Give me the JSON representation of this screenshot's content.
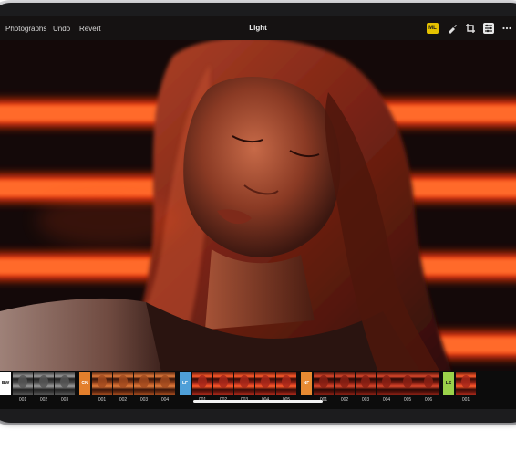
{
  "toolbar": {
    "photographs_label": "Photographs",
    "undo_label": "Undo",
    "revert_label": "Revert",
    "title": "Light",
    "ml_badge": "ML",
    "icons": [
      "ml-badge",
      "brush-icon",
      "crop-icon",
      "sliders-icon",
      "more-icon"
    ]
  },
  "filmstrip": {
    "groups": [
      {
        "tag": "BW",
        "color": "#ffffff",
        "tagText": "#111111",
        "tone": "bw",
        "thumbs": [
          "001",
          "002",
          "003"
        ]
      },
      {
        "tag": "CN",
        "color": "#e37f2c",
        "tagText": "#ffffff",
        "tone": "warm",
        "thumbs": [
          "001",
          "002",
          "003",
          "004"
        ]
      },
      {
        "tag": "LF",
        "color": "#4e9fd8",
        "tagText": "#ffffff",
        "tone": "red",
        "thumbs": [
          "001",
          "002",
          "003",
          "004",
          "005"
        ]
      },
      {
        "tag": "NF",
        "color": "#e78a32",
        "tagText": "#ffffff",
        "tone": "deep",
        "thumbs": [
          "001",
          "002",
          "003",
          "004",
          "005",
          "006"
        ]
      },
      {
        "tag": "LS",
        "color": "#9ad24a",
        "tagText": "#111111",
        "tone": "red",
        "thumbs": [
          "001"
        ]
      }
    ]
  },
  "colors": {
    "accent_ml": "#e6c200",
    "neon": "#ff4a12",
    "background": "#0d0909"
  }
}
